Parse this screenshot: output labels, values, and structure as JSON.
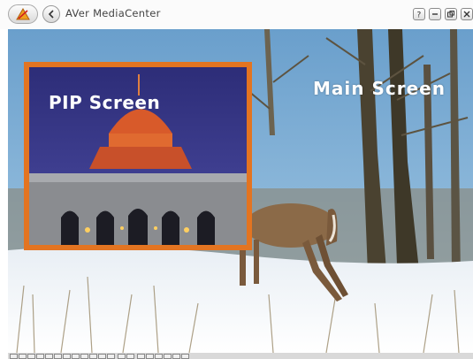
{
  "window": {
    "title": "AVer MediaCenter",
    "buttons": [
      "help-icon",
      "minimize-icon",
      "restore-icon",
      "close-icon"
    ]
  },
  "toolbar": {
    "home_icon": "aver-logo-icon",
    "back_icon": "back-arrow-icon"
  },
  "main_screen": {
    "label": "Main Screen"
  },
  "pip_screen": {
    "label": "PIP Screen",
    "border_color": "#e37421"
  },
  "control_strip": {
    "button_count": 20
  }
}
